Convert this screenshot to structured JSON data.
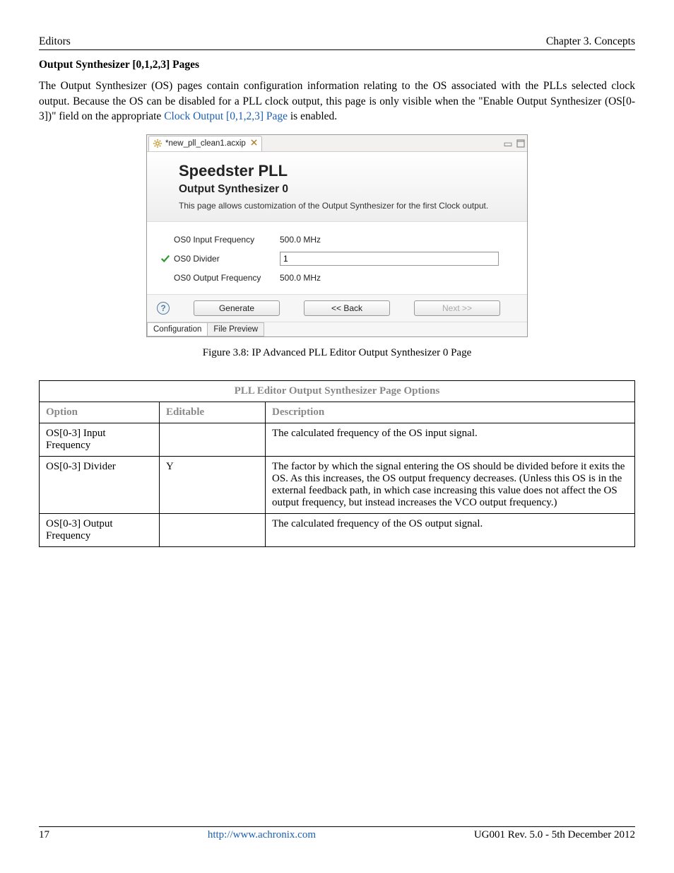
{
  "header": {
    "left": "Editors",
    "right": "Chapter 3. Concepts"
  },
  "section_title": "Output Synthesizer [0,1,2,3] Pages",
  "body_paragraph_pre": "The Output Synthesizer (OS) pages contain configuration information relating to the OS associated with the PLLs selected clock output. Because the OS can be disabled for a PLL clock output, this page is only visible when the \"Enable Output Synthesizer (OS[0-3])\" field on the appropriate ",
  "body_link": "Clock Output [0,1,2,3] Page",
  "body_paragraph_post": " is enabled.",
  "screenshot": {
    "tab_label": "*new_pll_clean1.acxip",
    "title": "Speedster PLL",
    "subtitle": "Output Synthesizer 0",
    "description": "This page allows customization of the Output Synthesizer for the first Clock output.",
    "rows": {
      "r1_label": "OS0 Input Frequency",
      "r1_value": "500.0 MHz",
      "r2_label": "OS0 Divider",
      "r2_value": "1",
      "r3_label": "OS0 Output Frequency",
      "r3_value": "500.0 MHz"
    },
    "buttons": {
      "generate": "Generate",
      "back": "<< Back",
      "next": "Next >>"
    },
    "bottom_tabs": {
      "config": "Configuration",
      "preview": "File Preview"
    }
  },
  "figure_caption": "Figure 3.8: IP Advanced PLL Editor Output Synthesizer 0 Page",
  "table": {
    "title": "PLL Editor Output Synthesizer Page Options",
    "headers": {
      "option": "Option",
      "editable": "Editable",
      "description": "Description"
    },
    "rows": [
      {
        "option": "OS[0-3] Input Frequency",
        "editable": "",
        "description": "The calculated frequency of the OS input signal."
      },
      {
        "option": "OS[0-3] Divider",
        "editable": "Y",
        "description": "The factor by which the signal entering the OS should be divided before it exits the OS. As this increases, the OS output frequency decreases. (Unless this OS is in the external feedback path, in which case increasing this value does not affect the OS output frequency, but instead increases the VCO output frequency.)"
      },
      {
        "option": "OS[0-3] Output Frequency",
        "editable": "",
        "description": "The calculated frequency of the OS output signal."
      }
    ]
  },
  "footer": {
    "page": "17",
    "url": "http://www.achronix.com",
    "rev": "UG001 Rev. 5.0 - 5th December 2012"
  }
}
